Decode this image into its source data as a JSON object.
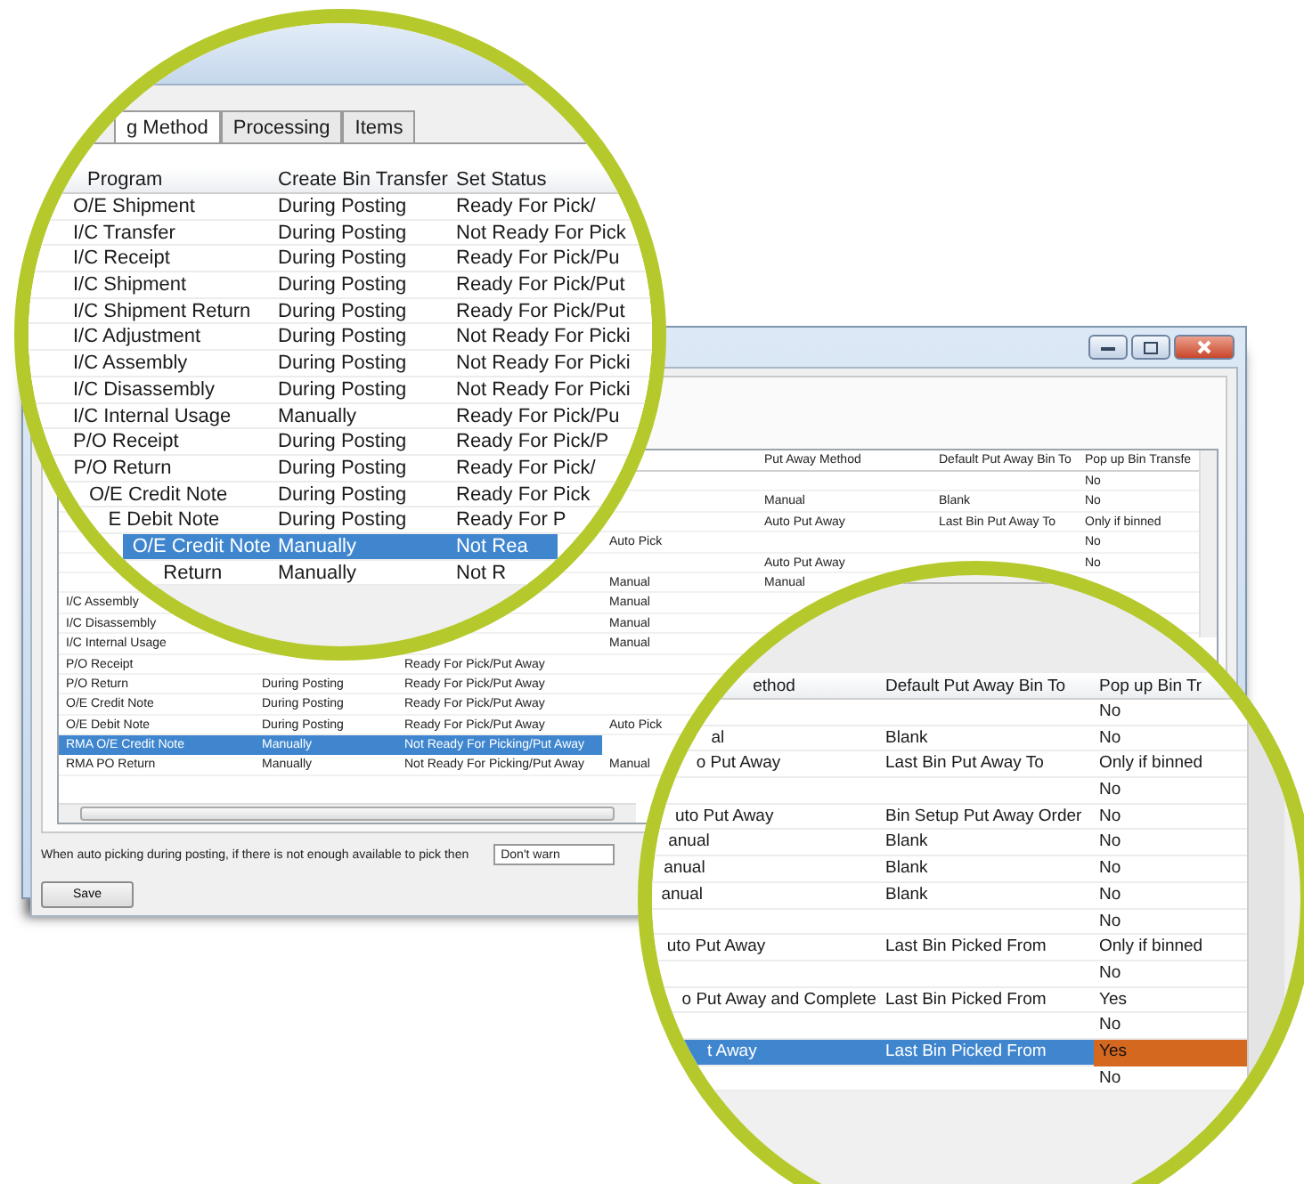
{
  "window": {
    "columns": [
      null,
      null,
      null,
      null,
      "Put Away Method",
      "Default Put Away Bin To",
      "Pop up Bin Transfe"
    ],
    "rows": [
      {
        "cells": [
          null,
          null,
          null,
          null,
          null,
          null,
          "No"
        ],
        "selected": false
      },
      {
        "cells": [
          null,
          null,
          null,
          null,
          "Manual",
          "Blank",
          "No"
        ],
        "selected": false
      },
      {
        "cells": [
          null,
          null,
          null,
          null,
          "Auto Put Away",
          "Last Bin Put Away To",
          "Only if binned"
        ],
        "selected": false
      },
      {
        "cells": [
          null,
          null,
          null,
          "Auto Pick",
          null,
          null,
          "No"
        ],
        "selected": false
      },
      {
        "cells": [
          null,
          null,
          null,
          null,
          "Auto Put Away",
          null,
          "No"
        ],
        "selected": false
      },
      {
        "cells": [
          null,
          null,
          null,
          "Manual",
          "Manual",
          null,
          null
        ],
        "selected": false
      },
      {
        "cells": [
          "I/C Assembly",
          null,
          null,
          "Manual",
          null,
          null,
          null
        ],
        "selected": false
      },
      {
        "cells": [
          "I/C Disassembly",
          null,
          null,
          "Manual",
          null,
          null,
          null
        ],
        "selected": false
      },
      {
        "cells": [
          "I/C Internal Usage",
          null,
          null,
          "Manual",
          null,
          null,
          null
        ],
        "selected": false
      },
      {
        "cells": [
          "P/O Receipt",
          null,
          "Ready For Pick/Put Away",
          null,
          null,
          null,
          null
        ],
        "selected": false
      },
      {
        "cells": [
          "P/O Return",
          "During Posting",
          "Ready For Pick/Put Away",
          null,
          null,
          null,
          null
        ],
        "selected": false
      },
      {
        "cells": [
          "O/E Credit Note",
          "During Posting",
          "Ready For Pick/Put Away",
          null,
          null,
          null,
          null
        ],
        "selected": false
      },
      {
        "cells": [
          "O/E Debit Note",
          "During Posting",
          "Ready For Pick/Put Away",
          "Auto Pick",
          null,
          null,
          null
        ],
        "selected": false
      },
      {
        "cells": [
          "RMA O/E Credit Note",
          "Manually",
          "Not Ready For Picking/Put Away",
          null,
          null,
          null,
          null
        ],
        "selected": true
      },
      {
        "cells": [
          "RMA PO Return",
          "Manually",
          "Not Ready For Picking/Put Away",
          "Manual",
          null,
          null,
          null
        ],
        "selected": false
      }
    ],
    "footer_label": "When auto picking during posting, if there is not enough available to pick then",
    "warning_dropdown": "Don't warn",
    "save_button": "Save"
  },
  "left_lens": {
    "tabs": [
      {
        "label": "g Method",
        "selected": true
      },
      {
        "label": "Processing",
        "selected": false
      },
      {
        "label": "Items",
        "selected": false
      }
    ],
    "columns": [
      "Program",
      "Create Bin Transfer",
      "Set Status"
    ],
    "rows": [
      {
        "cells": [
          "O/E Shipment",
          "During Posting",
          "Ready For Pick/"
        ],
        "selected": false
      },
      {
        "cells": [
          "I/C Transfer",
          "During Posting",
          "Not Ready For Pick"
        ],
        "selected": false
      },
      {
        "cells": [
          "I/C Receipt",
          "During Posting",
          "Ready For Pick/Pu"
        ],
        "selected": false
      },
      {
        "cells": [
          "I/C Shipment",
          "During Posting",
          "Ready For Pick/Put"
        ],
        "selected": false
      },
      {
        "cells": [
          "I/C Shipment Return",
          "During Posting",
          "Ready For Pick/Put"
        ],
        "selected": false
      },
      {
        "cells": [
          "I/C Adjustment",
          "During Posting",
          "Not Ready For Picki"
        ],
        "selected": false
      },
      {
        "cells": [
          "I/C Assembly",
          "During Posting",
          "Not Ready For Picki"
        ],
        "selected": false
      },
      {
        "cells": [
          "I/C Disassembly",
          "During Posting",
          "Not Ready For Picki"
        ],
        "selected": false
      },
      {
        "cells": [
          "I/C Internal Usage",
          "Manually",
          "Ready For Pick/Pu"
        ],
        "selected": false
      },
      {
        "cells": [
          "P/O Receipt",
          "During Posting",
          "Ready For Pick/P"
        ],
        "selected": false
      },
      {
        "cells": [
          "P/O Return",
          "During Posting",
          "Ready For Pick/"
        ],
        "selected": false
      },
      {
        "cells": [
          "O/E Credit Note",
          "During Posting",
          "Ready For Pick"
        ],
        "selected": false
      },
      {
        "cells": [
          "E Debit Note",
          "During Posting",
          "Ready For P"
        ],
        "selected": false
      },
      {
        "cells": [
          "O/E Credit Note",
          "Manually",
          "Not Rea"
        ],
        "selected": true
      },
      {
        "cells": [
          "Return",
          "Manually",
          "Not R"
        ],
        "selected": false
      }
    ]
  },
  "right_lens": {
    "columns": [
      "ethod",
      "Default Put Away Bin To",
      "Pop up Bin Tr"
    ],
    "rows": [
      {
        "cells": [
          null,
          null,
          "No"
        ],
        "selected": false,
        "highlighted": false
      },
      {
        "cells": [
          "al",
          "Blank",
          "No"
        ],
        "selected": false,
        "highlighted": false
      },
      {
        "cells": [
          "o Put Away",
          "Last Bin Put Away To",
          "Only if binned"
        ],
        "selected": false,
        "highlighted": false
      },
      {
        "cells": [
          null,
          null,
          "No"
        ],
        "selected": false,
        "highlighted": false
      },
      {
        "cells": [
          "uto Put Away",
          "Bin Setup Put Away Order",
          "No"
        ],
        "selected": false,
        "highlighted": false
      },
      {
        "cells": [
          "anual",
          "Blank",
          "No"
        ],
        "selected": false,
        "highlighted": false
      },
      {
        "cells": [
          "anual",
          "Blank",
          "No"
        ],
        "selected": false,
        "highlighted": false
      },
      {
        "cells": [
          "anual",
          "Blank",
          "No"
        ],
        "selected": false,
        "highlighted": false
      },
      {
        "cells": [
          null,
          null,
          "No"
        ],
        "selected": false,
        "highlighted": false
      },
      {
        "cells": [
          "uto Put Away",
          "Last Bin Picked From",
          "Only if binned"
        ],
        "selected": false,
        "highlighted": false
      },
      {
        "cells": [
          null,
          null,
          "No"
        ],
        "selected": false,
        "highlighted": false
      },
      {
        "cells": [
          "o Put Away and Complete",
          "Last Bin Picked From",
          "Yes"
        ],
        "selected": false,
        "highlighted": false
      },
      {
        "cells": [
          null,
          null,
          "No"
        ],
        "selected": false,
        "highlighted": false
      },
      {
        "cells": [
          "t Away",
          "Last Bin Picked From",
          "Yes"
        ],
        "selected": true,
        "highlighted": true
      },
      {
        "cells": [
          null,
          null,
          "No"
        ],
        "selected": false,
        "highlighted": false
      }
    ]
  }
}
